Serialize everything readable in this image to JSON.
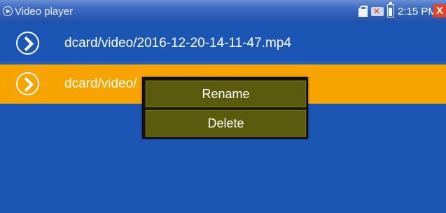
{
  "status_bar": {
    "app_title": "Video player",
    "time": "2:15 PM",
    "icons": [
      "play-circle-icon",
      "sd-card-icon",
      "network-disconnected-icon",
      "battery-icon",
      "close-icon"
    ],
    "close_label": "X"
  },
  "file_list": [
    {
      "name": "dcard/video/2016-12-20-14-11-47.mp4",
      "selected": false,
      "icon": "play-circle-icon"
    },
    {
      "name": "dcard/video/",
      "selected": true,
      "icon": "play-circle-icon"
    }
  ],
  "context_menu": {
    "items": [
      "Rename",
      "Delete"
    ]
  },
  "colors": {
    "background": "#1c56b4",
    "selected_row": "#f7a400",
    "menu_item": "#5b5b0e",
    "close_button": "#e64225"
  }
}
